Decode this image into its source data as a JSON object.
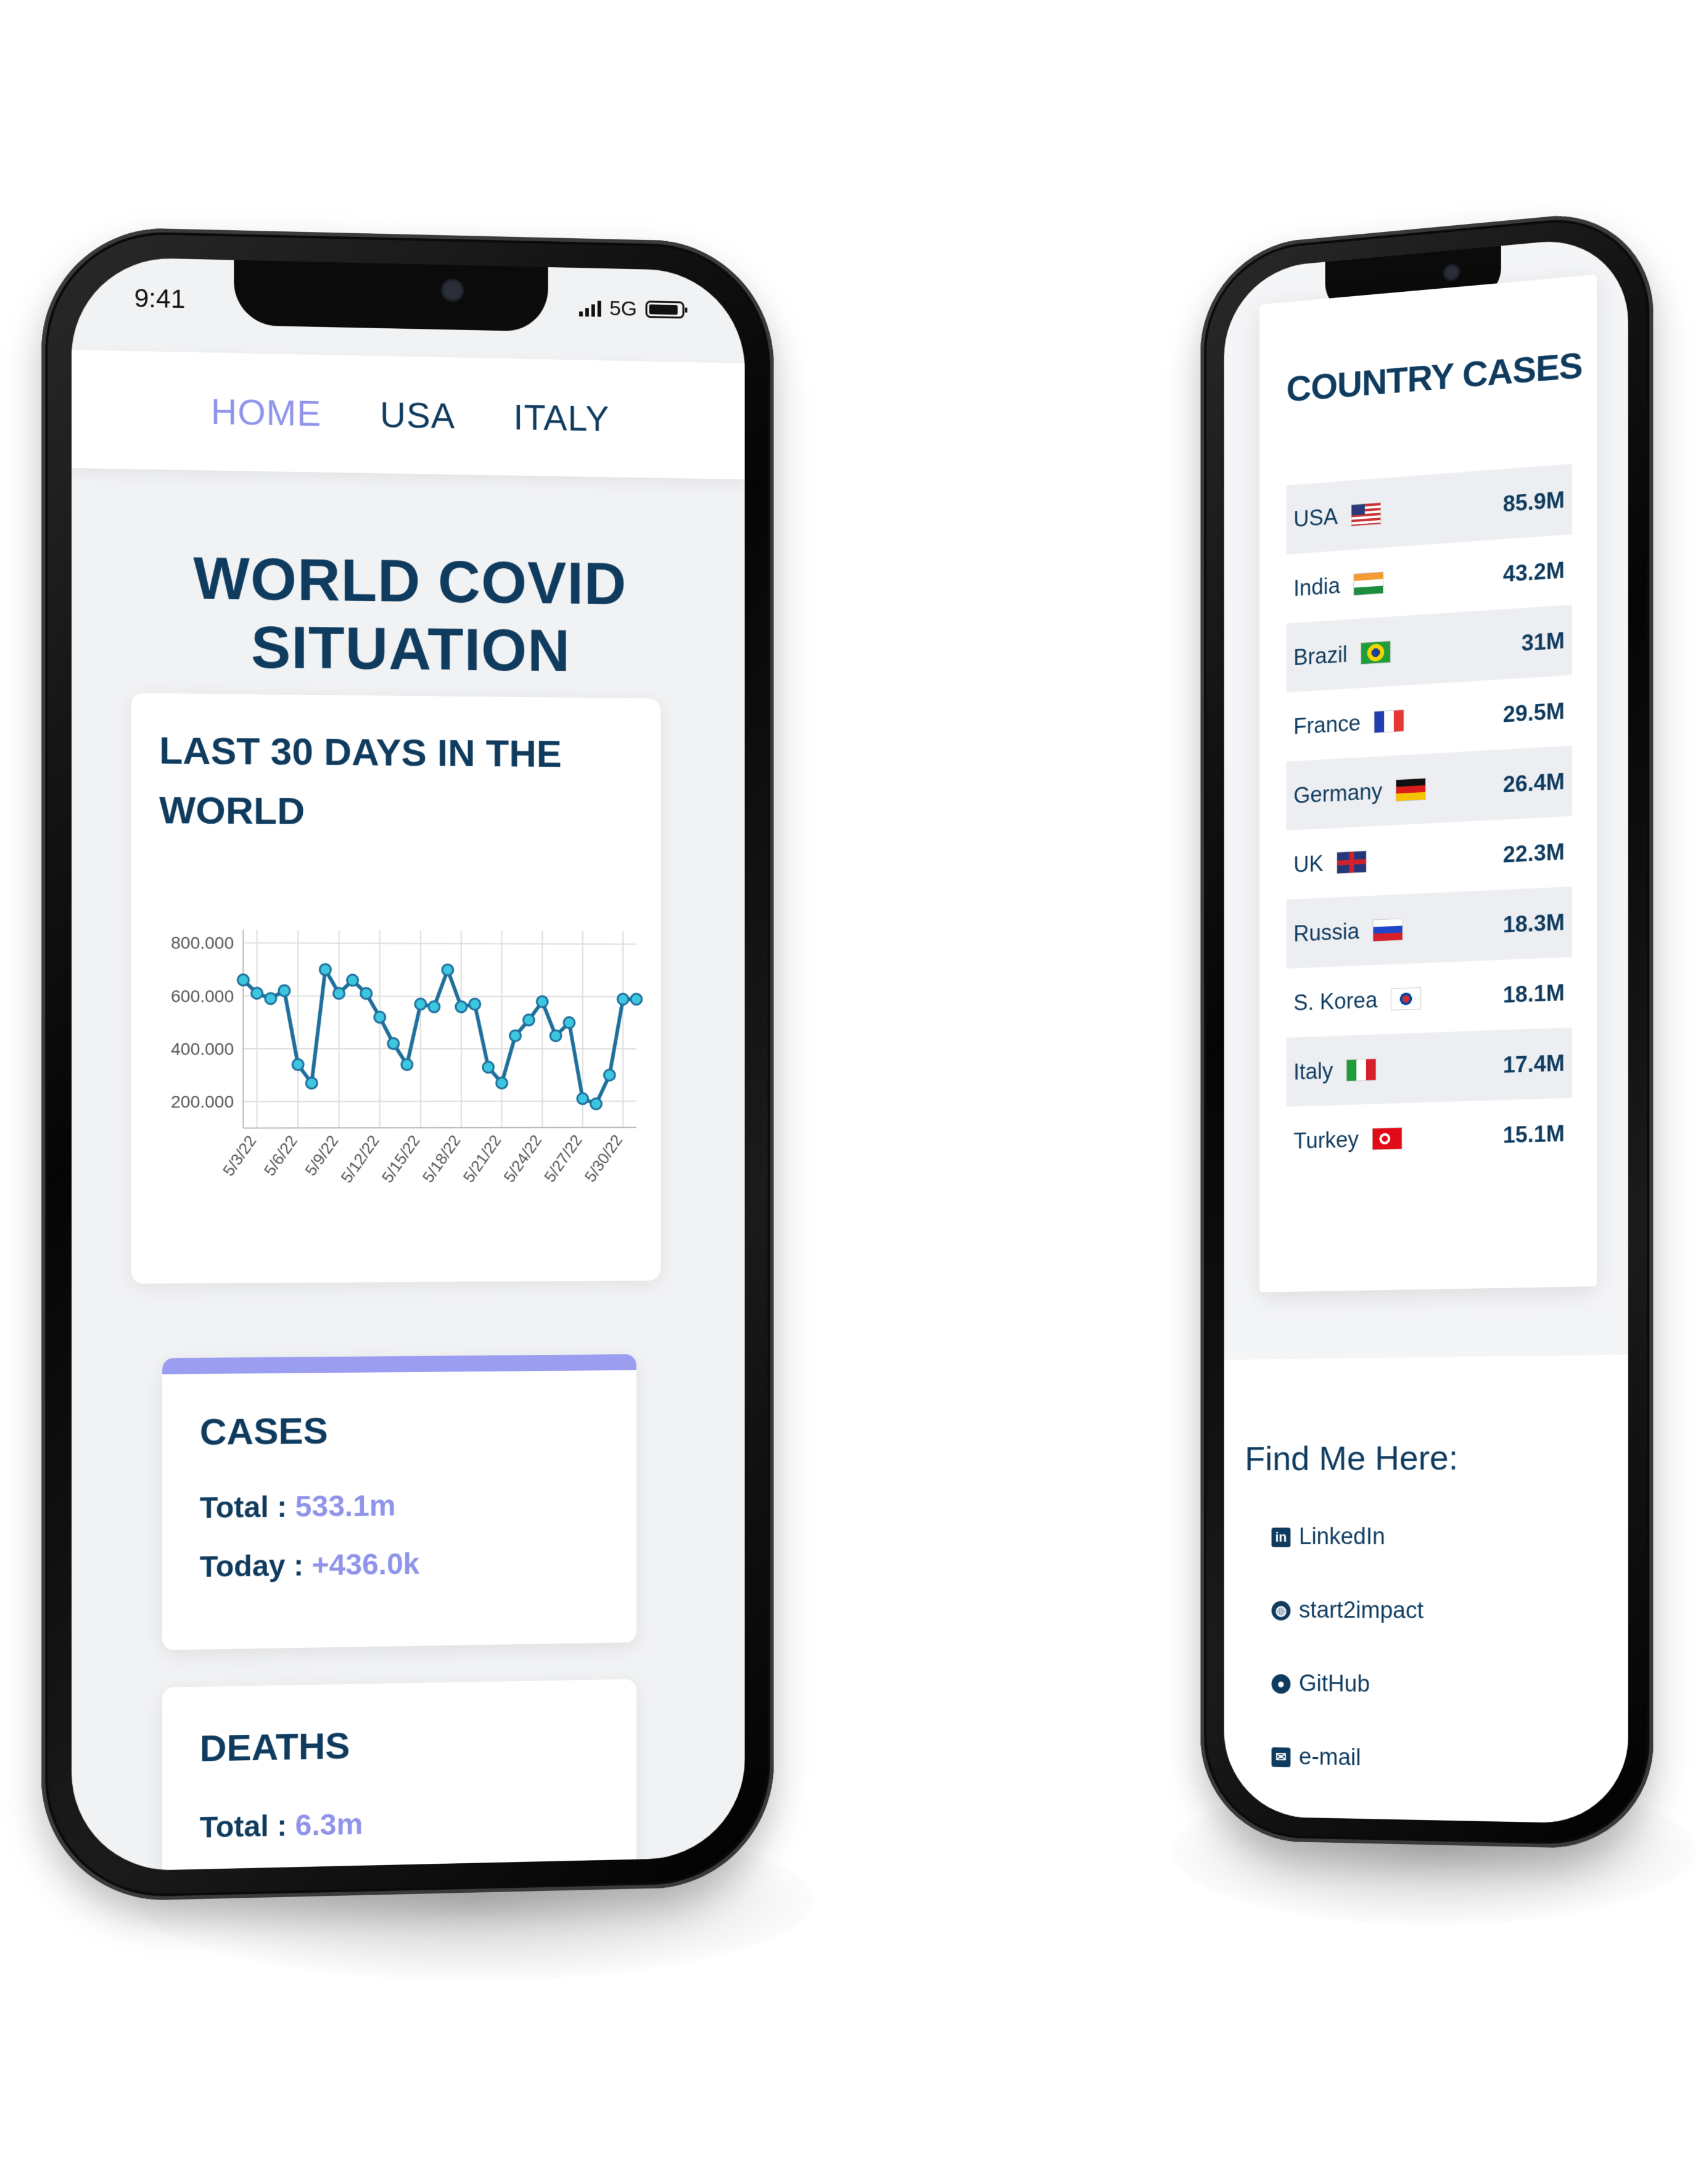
{
  "left_phone": {
    "status": {
      "time": "9:41",
      "network": "5G"
    },
    "nav": [
      {
        "label": "HOME",
        "active": true
      },
      {
        "label": "USA",
        "active": false
      },
      {
        "label": "ITALY",
        "active": false
      }
    ],
    "page_title": "WORLD COVID SITUATION",
    "chart_card": {
      "title_line1": "LAST 30 DAYS IN THE",
      "title_line2": "WORLD"
    },
    "cases": {
      "title": "CASES",
      "total_label": "Total : ",
      "total_value": "533.1m",
      "today_label": "Today : ",
      "today_value": "+436.0k"
    },
    "deaths": {
      "title": "DEATHS",
      "total_label": "Total : ",
      "total_value": "6.3m"
    }
  },
  "chart_data": {
    "type": "line",
    "title": "LAST 30 DAYS IN THE WORLD",
    "xlabel": "",
    "ylabel": "",
    "x_tick_labels": [
      "5/3/22",
      "5/6/22",
      "5/9/22",
      "5/12/22",
      "5/15/22",
      "5/18/22",
      "5/21/22",
      "5/24/22",
      "5/27/22",
      "5/30/22"
    ],
    "y_tick_labels": [
      "200.000",
      "400.000",
      "600.000",
      "800.000"
    ],
    "y_ticks": [
      200000,
      400000,
      600000,
      800000
    ],
    "ylim": [
      100000,
      850000
    ],
    "grid": true,
    "series": [
      {
        "color": "#1f6f9c",
        "marker_color": "#3cc6e0",
        "x": [
          "5/2/22",
          "5/3/22",
          "5/4/22",
          "5/5/22",
          "5/6/22",
          "5/7/22",
          "5/8/22",
          "5/9/22",
          "5/10/22",
          "5/11/22",
          "5/12/22",
          "5/13/22",
          "5/14/22",
          "5/15/22",
          "5/16/22",
          "5/17/22",
          "5/18/22",
          "5/19/22",
          "5/20/22",
          "5/21/22",
          "5/22/22",
          "5/23/22",
          "5/24/22",
          "5/25/22",
          "5/26/22",
          "5/27/22",
          "5/28/22",
          "5/29/22",
          "5/30/22",
          "5/31/22"
        ],
        "values": [
          660000,
          610000,
          590000,
          620000,
          340000,
          270000,
          700000,
          610000,
          660000,
          610000,
          520000,
          420000,
          340000,
          570000,
          560000,
          700000,
          560000,
          570000,
          330000,
          270000,
          450000,
          510000,
          580000,
          450000,
          500000,
          210000,
          190000,
          300000,
          590000,
          590000
        ]
      }
    ]
  },
  "right_phone": {
    "card_title": "COUNTRY CASES",
    "countries": [
      {
        "name": "USA",
        "flag": "flag-usa",
        "value": "85.9M"
      },
      {
        "name": "India",
        "flag": "flag-india",
        "value": "43.2M"
      },
      {
        "name": "Brazil",
        "flag": "flag-brazil",
        "value": "31M"
      },
      {
        "name": "France",
        "flag": "flag-france",
        "value": "29.5M"
      },
      {
        "name": "Germany",
        "flag": "flag-germany",
        "value": "26.4M"
      },
      {
        "name": "UK",
        "flag": "flag-uk",
        "value": "22.3M"
      },
      {
        "name": "Russia",
        "flag": "flag-russia",
        "value": "18.3M"
      },
      {
        "name": "S. Korea",
        "flag": "flag-south-korea",
        "value": "18.1M"
      },
      {
        "name": "Italy",
        "flag": "flag-italy",
        "value": "17.4M"
      },
      {
        "name": "Turkey",
        "flag": "flag-turkey",
        "value": "15.1M"
      }
    ],
    "footer_title": "Find Me Here:",
    "links": [
      {
        "label": "LinkedIn",
        "icon": "linkedin-icon"
      },
      {
        "label": "start2impact",
        "icon": "globe-icon"
      },
      {
        "label": "GitHub",
        "icon": "github-icon"
      },
      {
        "label": "e-mail",
        "icon": "email-icon"
      }
    ]
  },
  "colors": {
    "navy": "#0f3b5f",
    "accent": "#8f93ea",
    "line": "#1f6f9c",
    "marker": "#3cc6e0"
  }
}
